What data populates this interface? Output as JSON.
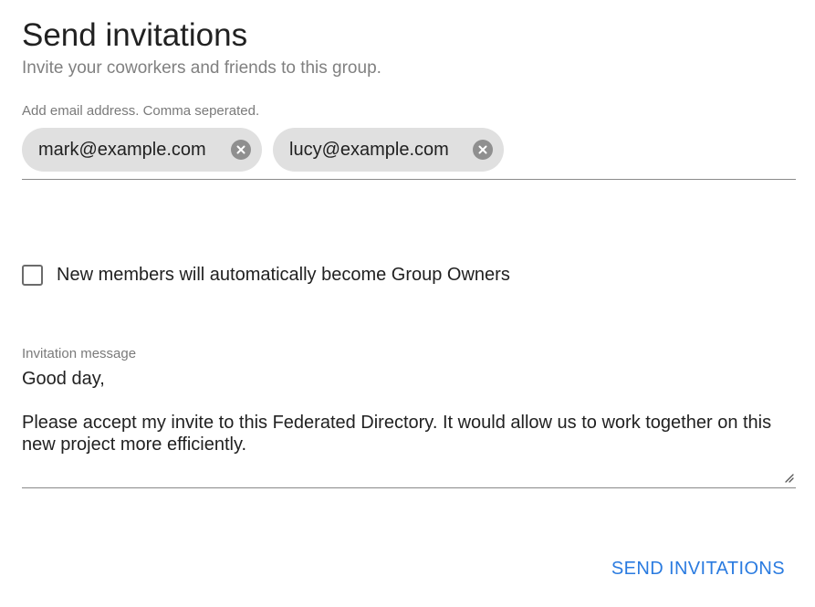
{
  "header": {
    "title": "Send invitations",
    "subtitle": "Invite your coworkers and friends to this group."
  },
  "email_field": {
    "label": "Add email address. Comma seperated.",
    "chips": [
      {
        "email": "mark@example.com",
        "remove_icon": "close-circle-icon"
      },
      {
        "email": "lucy@example.com",
        "remove_icon": "close-circle-icon"
      }
    ]
  },
  "group_owners_checkbox": {
    "label": "New members will automatically become Group Owners",
    "checked": false
  },
  "message_field": {
    "label": "Invitation message",
    "lines": [
      "Good day,",
      "",
      "Please accept my invite to this Federated Directory. It would allow us to work together on this new project more efficiently."
    ]
  },
  "actions": {
    "send_label": "SEND INVITATIONS"
  },
  "colors": {
    "accent": "#2a7be0",
    "chip_background": "#e0e0e0",
    "chip_remove": "#8f8f8f"
  }
}
